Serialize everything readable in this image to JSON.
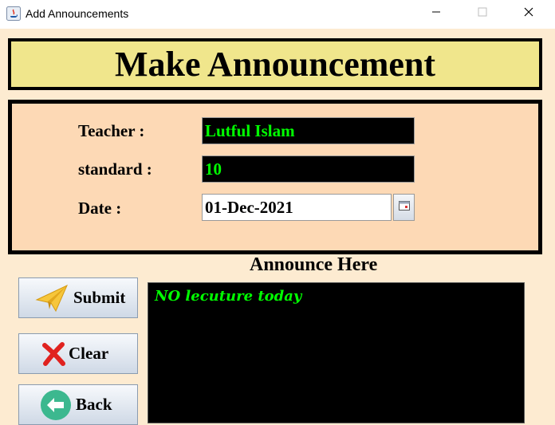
{
  "window": {
    "title": "Add Announcements",
    "icon": "java-icon",
    "controls": [
      "minimize-icon",
      "maximize-icon",
      "close-icon"
    ]
  },
  "header": {
    "title": "Make Announcement"
  },
  "form": {
    "teacher_label": "Teacher :",
    "teacher_value": "Lutful Islam",
    "standard_label": "standard :",
    "standard_value": "10",
    "date_label": "Date :",
    "date_value": "01-Dec-2021",
    "date_picker_icon": "calendar-icon"
  },
  "announce": {
    "title": "Announce Here",
    "text": "NO lecuture today"
  },
  "buttons": {
    "submit": {
      "label": "Submit",
      "icon": "paper-plane-icon"
    },
    "clear": {
      "label": "Clear",
      "icon": "red-x-icon"
    },
    "back": {
      "label": "Back",
      "icon": "back-arrow-icon"
    }
  },
  "colors": {
    "background": "#fdebd1",
    "header_bg": "#f0e68c",
    "form_bg": "#fdd9b5",
    "field_text_green": "#00ff00",
    "field_dark_bg": "#000000"
  }
}
